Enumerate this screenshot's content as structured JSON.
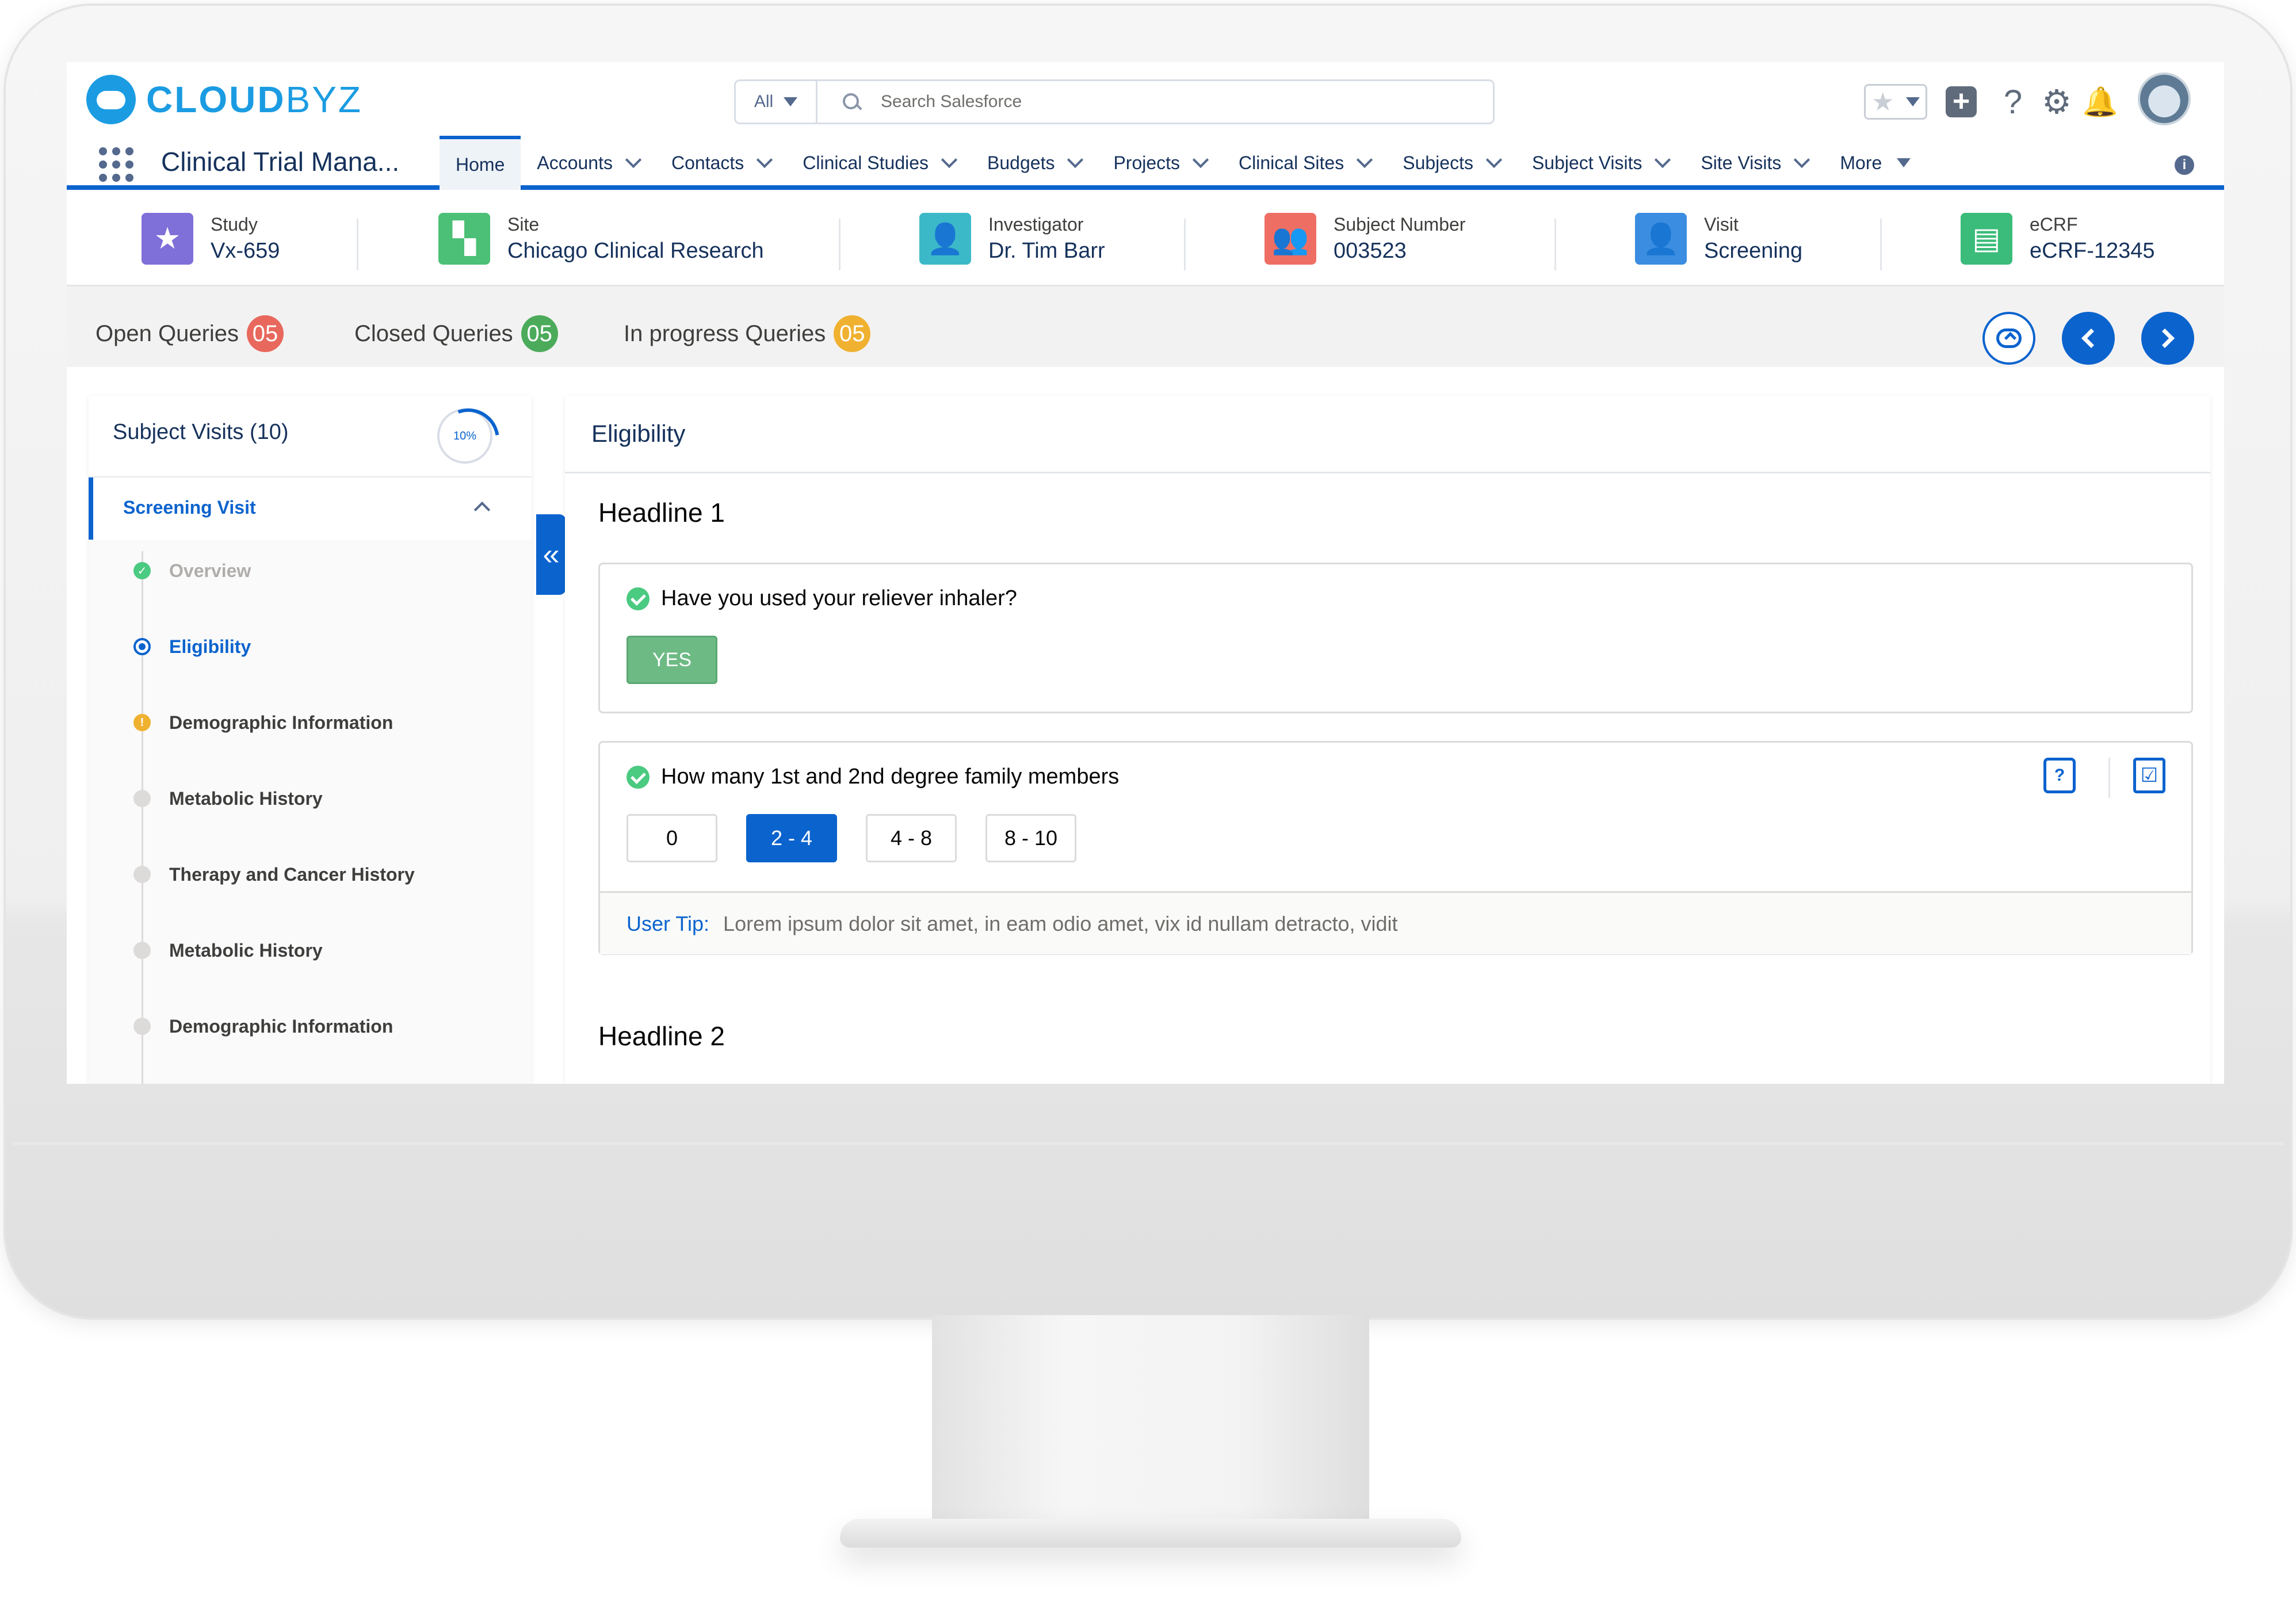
{
  "brand": {
    "logo_main": "CLOUD",
    "logo_accent": "BYZ",
    "accent_color": "#0b63ce",
    "logo_color": "#1b9ce2"
  },
  "header": {
    "app_name": "Clinical Trial Mana...",
    "search_scope": "All",
    "search_placeholder": "Search Salesforce",
    "utility_icons": [
      "favorites-icon",
      "add-icon",
      "help-icon",
      "settings-icon",
      "notifications-icon",
      "avatar"
    ]
  },
  "nav": {
    "items": [
      {
        "label": "Home",
        "active": true
      },
      {
        "label": "Accounts"
      },
      {
        "label": "Contacts"
      },
      {
        "label": "Clinical Studies"
      },
      {
        "label": "Budgets"
      },
      {
        "label": "Projects"
      },
      {
        "label": "Clinical Sites"
      },
      {
        "label": "Subjects"
      },
      {
        "label": "Subject Visits"
      },
      {
        "label": "Site Visits"
      },
      {
        "label": "More"
      }
    ]
  },
  "highlights": [
    {
      "label": "Study",
      "value": "Vx-659",
      "icon": "star-icon",
      "color": "#7f6fd8"
    },
    {
      "label": "Site",
      "value": "Chicago Clinical Research",
      "icon": "map-icon",
      "color": "#4bc076"
    },
    {
      "label": "Investigator",
      "value": "Dr. Tim Barr",
      "icon": "person-icon",
      "color": "#3cb9c9"
    },
    {
      "label": "Subject Number",
      "value": "003523",
      "icon": "people-icon",
      "color": "#ef6e64"
    },
    {
      "label": "Visit",
      "value": "Screening",
      "icon": "visit-icon",
      "color": "#3a8de0"
    },
    {
      "label": "eCRF",
      "value": "eCRF-12345",
      "icon": "document-icon",
      "color": "#3bbc7a"
    }
  ],
  "queries": [
    {
      "label": "Open Queries",
      "count": "05",
      "color": "#e8685d"
    },
    {
      "label": "Closed Queries",
      "count": "05",
      "color": "#4bab5b"
    },
    {
      "label": "In progress Queries",
      "count": "05",
      "color": "#f0b131"
    }
  ],
  "left_panel": {
    "title": "Subject Visits (10)",
    "progress_label": "10%",
    "progress": 0.1,
    "section": "Screening Visit",
    "steps": [
      {
        "label": "Overview",
        "status": "complete"
      },
      {
        "label": "Eligibility",
        "status": "current"
      },
      {
        "label": "Demographic Information",
        "status": "warning"
      },
      {
        "label": "Metabolic History",
        "status": "pending"
      },
      {
        "label": "Therapy and Cancer History",
        "status": "pending"
      },
      {
        "label": "Metabolic History",
        "status": "pending"
      },
      {
        "label": "Demographic Information",
        "status": "pending"
      }
    ]
  },
  "main": {
    "title": "Eligibility",
    "headline1": "Headline 1",
    "headline2": "Headline 2",
    "q1": {
      "text": "Have you used your reliever inhaler?",
      "answer": "YES"
    },
    "q2": {
      "text": "How many 1st and 2nd degree family members",
      "options": [
        "0",
        "2 - 4",
        "4 - 8",
        "8 - 10"
      ],
      "selected": "2 - 4",
      "tip_label": "User Tip:",
      "tip_text": "Lorem ipsum dolor sit amet, in eam odio amet, vix id nullam detracto, vidit"
    }
  }
}
